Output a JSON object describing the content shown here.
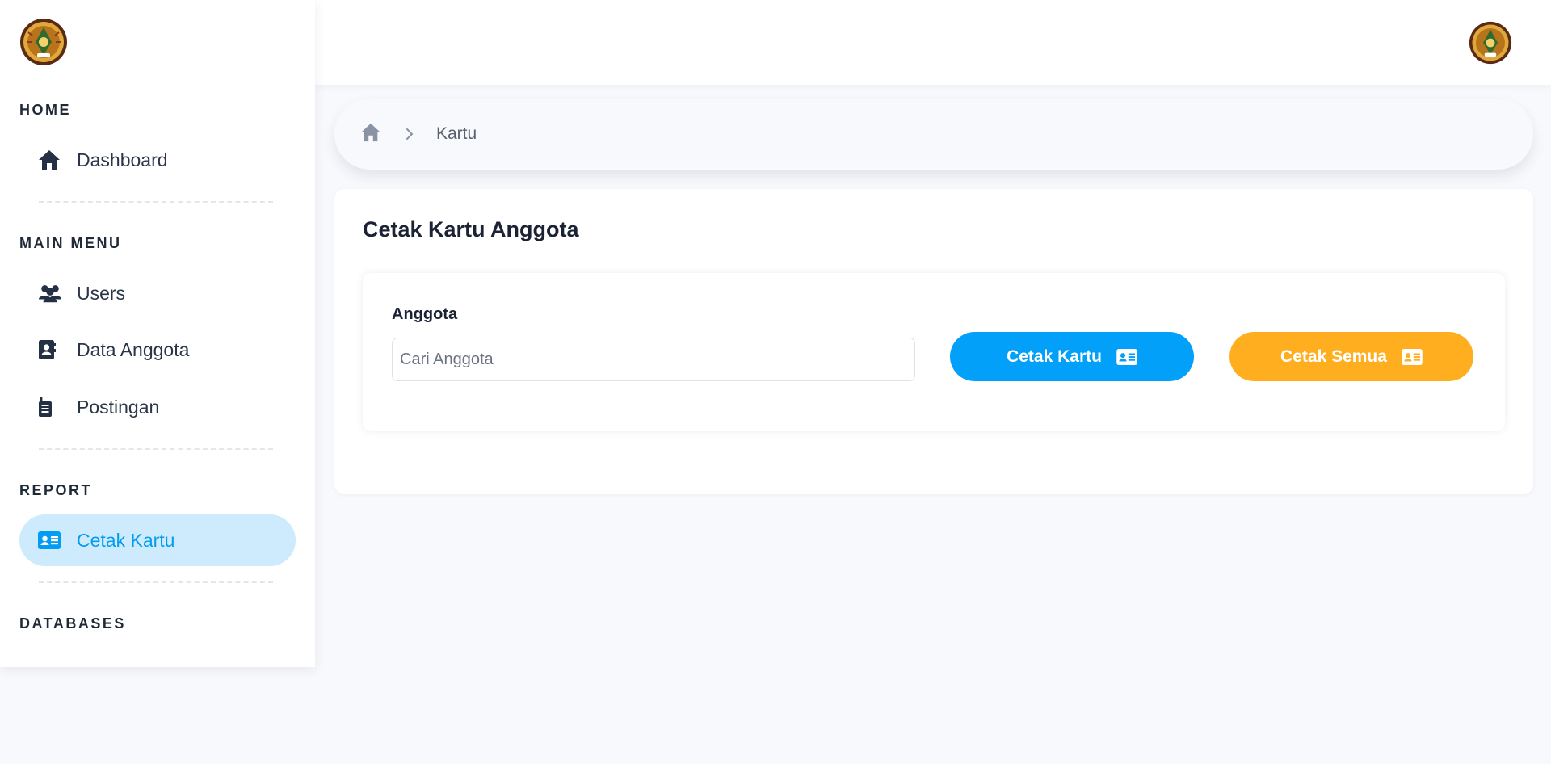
{
  "sidebar": {
    "sections": {
      "home": "HOME",
      "main_menu": "MAIN MENU",
      "report": "REPORT",
      "databases": "DATABASES"
    },
    "items": {
      "dashboard": "Dashboard",
      "users": "Users",
      "data_anggota": "Data Anggota",
      "postingan": "Postingan",
      "cetak_kartu": "Cetak Kartu"
    },
    "active_item": "Cetak Kartu"
  },
  "breadcrumb": {
    "current": "Kartu"
  },
  "page": {
    "title": "Cetak Kartu Anggota",
    "field_label": "Anggota",
    "search_placeholder": "Cari Anggota",
    "search_value": "",
    "btn_cetak_kartu": "Cetak Kartu",
    "btn_cetak_semua": "Cetak Semua"
  },
  "colors": {
    "accent_blue": "#03a0f9",
    "accent_orange": "#ffae1f",
    "active_bg": "#cdebfc",
    "text_dark": "#2a3547"
  },
  "icons": {
    "home": "home-icon",
    "users": "users-icon",
    "data_anggota": "address-book-icon",
    "postingan": "walkie-talkie-icon",
    "cetak_kartu": "id-card-icon",
    "breadcrumb_home": "home-icon",
    "breadcrumb_separator": "chevron-right-icon"
  }
}
